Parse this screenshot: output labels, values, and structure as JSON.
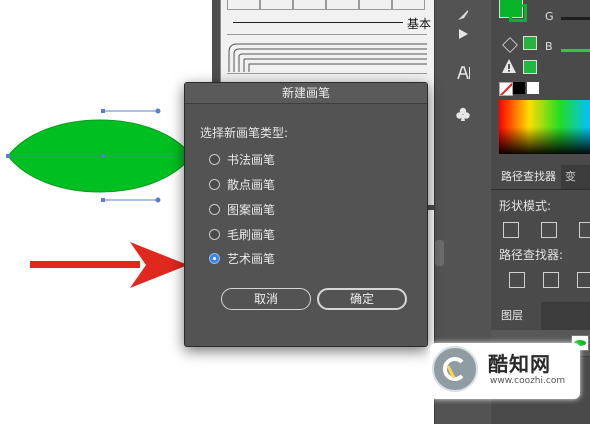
{
  "dialog": {
    "title": "新建画笔",
    "prompt": "选择新画笔类型:",
    "options": [
      {
        "label": "书法画笔",
        "selected": false
      },
      {
        "label": "散点画笔",
        "selected": false
      },
      {
        "label": "图案画笔",
        "selected": false
      },
      {
        "label": "毛刷画笔",
        "selected": false
      },
      {
        "label": "艺术画笔",
        "selected": true
      }
    ],
    "cancel_label": "取消",
    "ok_label": "确定"
  },
  "brush_panel": {
    "basic_label": "基本"
  },
  "color_panel": {
    "g_label": "G",
    "b_label": "B"
  },
  "pathfinder_panel": {
    "tab_active": "路径查找器",
    "tab_other": "变",
    "shape_modes_label": "形状模式:",
    "pathfinders_label": "路径查找器:"
  },
  "layers_panel": {
    "tab_label": "图层"
  },
  "watermark": {
    "name": "酷知网",
    "url": "www.coozhi.com"
  },
  "colors": {
    "leaf_fill": "#00c021",
    "arrow": "#e0281e",
    "radio_selected": "#3d86e8",
    "dialog_bg": "#535353"
  }
}
